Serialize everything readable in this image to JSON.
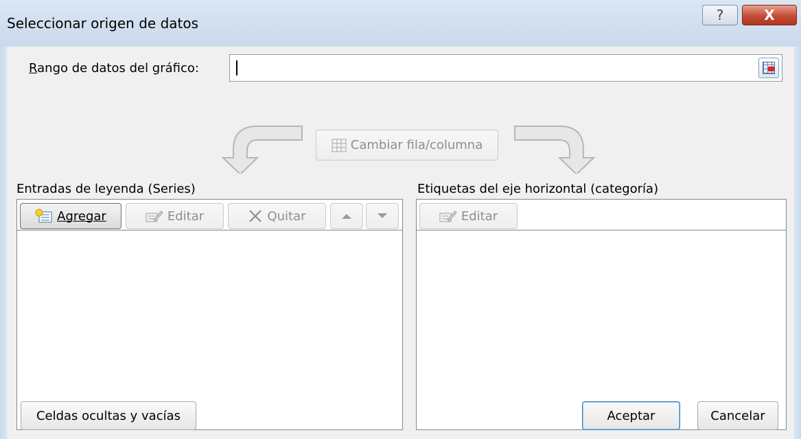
{
  "window": {
    "title": "Seleccionar origen de datos",
    "help_label": "?",
    "close_label": "X"
  },
  "range": {
    "label": "Rango de datos del gráfico:",
    "value": ""
  },
  "switch_button": {
    "label": "Cambiar fila/columna",
    "enabled": false
  },
  "series_panel": {
    "title": "Entradas de leyenda (Series)",
    "add_label": "Agregar",
    "edit_label": "Editar",
    "remove_label": "Quitar",
    "items": []
  },
  "category_panel": {
    "title": "Etiquetas del eje horizontal (categoría)",
    "edit_label": "Editar",
    "items": []
  },
  "footer": {
    "hidden_cells_label": "Celdas ocultas y vacías",
    "ok_label": "Aceptar",
    "cancel_label": "Cancelar"
  },
  "colors": {
    "dialog_bg": "#f0f0f0",
    "title_bar": "#c9d9ec",
    "close_button": "#c44b34",
    "primary_border": "#3c7fb1"
  },
  "icons": {
    "collapse": "range-collapse-icon",
    "switch": "switch-row-column-icon",
    "add": "add-series-icon",
    "edit": "edit-pencil-icon",
    "remove": "remove-x-icon",
    "up": "move-up-icon",
    "down": "move-down-icon"
  }
}
